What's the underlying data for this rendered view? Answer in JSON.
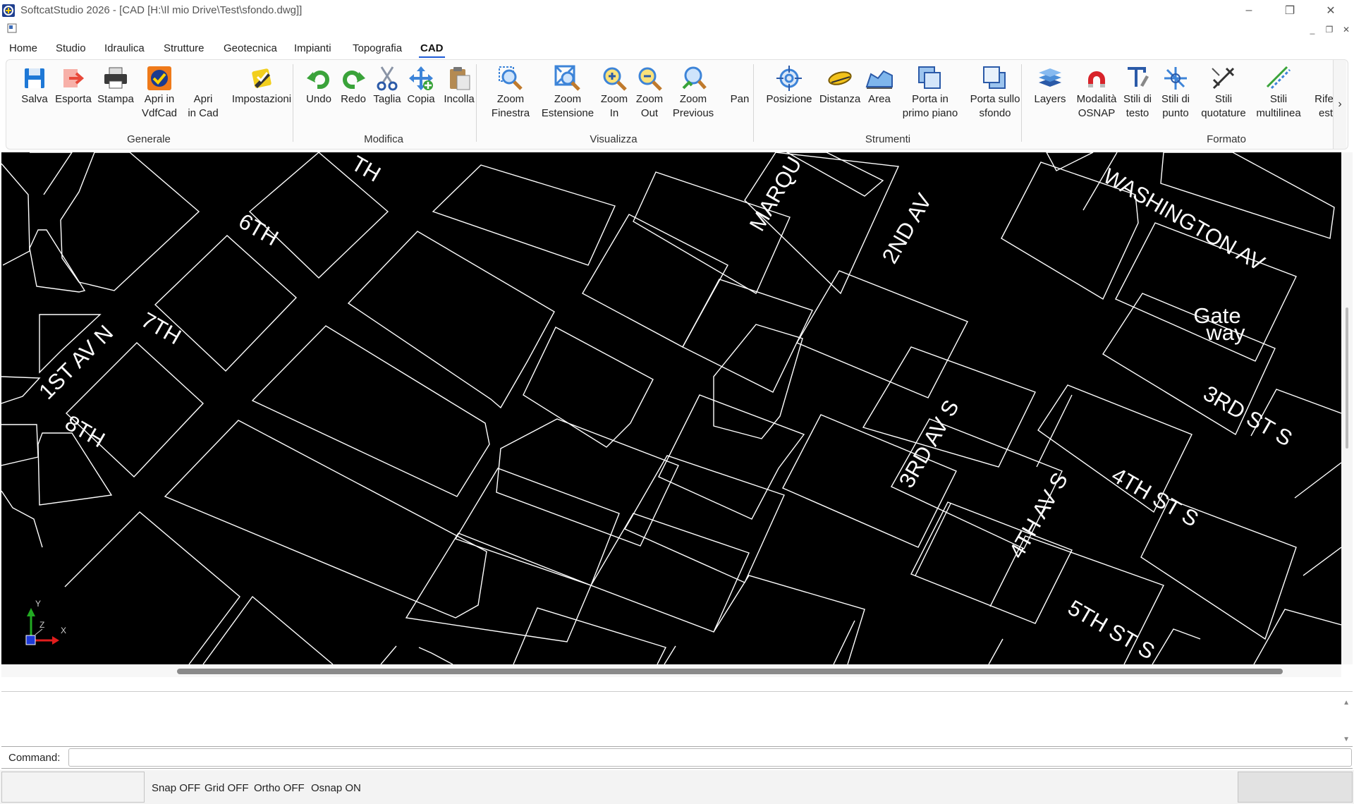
{
  "window": {
    "title": "SoftcatStudio 2026 - [CAD [H:\\Il mio Drive\\Test\\sfondo.dwg]]",
    "minimize_glyph": "–",
    "restore_glyph": "❐",
    "close_glyph": "✕"
  },
  "mdi": {
    "minimize_glyph": "_",
    "restore_glyph": "❐",
    "close_glyph": "✕"
  },
  "menu": {
    "tabs": [
      "Home",
      "Studio",
      "Idraulica",
      "Strutture",
      "Geotecnica",
      "Impianti",
      "Topografia",
      "CAD"
    ],
    "active": "CAD"
  },
  "ribbon": {
    "groups": [
      {
        "label": "Generale",
        "buttons": [
          {
            "label": "Salva",
            "icon": "floppy-disk-icon"
          },
          {
            "label": "Esporta",
            "icon": "export-arrow-icon"
          },
          {
            "label": "Stampa",
            "icon": "printer-icon"
          },
          {
            "label": "Apri in\nVdfCad",
            "icon": "vdfcad-logo-icon"
          },
          {
            "label": "Apri\nin Cad",
            "icon": ""
          },
          {
            "label": "Impostazioni",
            "icon": "settings-pencil-icon"
          }
        ]
      },
      {
        "label": "Modifica",
        "buttons": [
          {
            "label": "Undo",
            "icon": "undo-arrow-icon"
          },
          {
            "label": "Redo",
            "icon": "redo-arrow-icon"
          },
          {
            "label": "Taglia",
            "icon": "scissors-icon"
          },
          {
            "label": "Copia",
            "icon": "copy-move-icon"
          },
          {
            "label": "Incolla",
            "icon": "paste-clipboard-icon"
          }
        ]
      },
      {
        "label": "Visualizza",
        "buttons": [
          {
            "label": "Zoom\nFinestra",
            "icon": "zoom-window-icon"
          },
          {
            "label": "Zoom\nEstensione",
            "icon": "zoom-extents-icon"
          },
          {
            "label": "Zoom\nIn",
            "icon": "zoom-in-icon"
          },
          {
            "label": "Zoom\nOut",
            "icon": "zoom-out-icon"
          },
          {
            "label": "Zoom\nPrevious",
            "icon": "zoom-previous-icon"
          },
          {
            "label": "Pan",
            "icon": ""
          }
        ]
      },
      {
        "label": "Strumenti",
        "buttons": [
          {
            "label": "Posizione",
            "icon": "crosshair-target-icon"
          },
          {
            "label": "Distanza",
            "icon": "tape-measure-icon"
          },
          {
            "label": "Area",
            "icon": "area-icon"
          },
          {
            "label": "Porta in\nprimo piano",
            "icon": "bring-to-front-icon"
          },
          {
            "label": "Porta sullo\nsfondo",
            "icon": "send-to-back-icon"
          }
        ]
      },
      {
        "label": "Formato",
        "buttons": [
          {
            "label": "Layers",
            "icon": "layers-icon"
          },
          {
            "label": "Modalità\nOSNAP",
            "icon": "magnet-icon"
          },
          {
            "label": "Stili di\ntesto",
            "icon": "text-style-icon"
          },
          {
            "label": "Stili di\npunto",
            "icon": "point-style-icon"
          },
          {
            "label": "Stili\nquotature",
            "icon": "dimension-style-icon"
          },
          {
            "label": "Stili\nmultilinea",
            "icon": "multiline-style-icon"
          },
          {
            "label": "Rifer\nest",
            "icon": "external-reference-icon"
          }
        ]
      }
    ],
    "scroll_glyph": "›"
  },
  "drawing": {
    "streets": [
      "WASHINGTON AV",
      "2ND AV",
      "MARQU",
      "6TH",
      "7TH",
      "8TH",
      "1ST AV N",
      "3RD AV S",
      "4TH AV S",
      "3RD ST S",
      "4TH ST S",
      "5TH ST S",
      "TH"
    ],
    "landmark_line1": "Gate",
    "landmark_line2": "way",
    "ucs": {
      "x_label": "X",
      "y_label": "Y",
      "z_label": "Z"
    },
    "colors": {
      "background": "#000000",
      "lines": "#ffffff",
      "x_axis": "#e11d1d",
      "y_axis": "#22aa22",
      "origin": "#1e3ad6"
    }
  },
  "command": {
    "label": "Command:",
    "value": "",
    "scroll_up": "▲",
    "scroll_down": "▼"
  },
  "status": {
    "snap": "Snap OFF",
    "grid": "Grid OFF",
    "ortho": "Ortho OFF",
    "osnap": "Osnap ON"
  }
}
